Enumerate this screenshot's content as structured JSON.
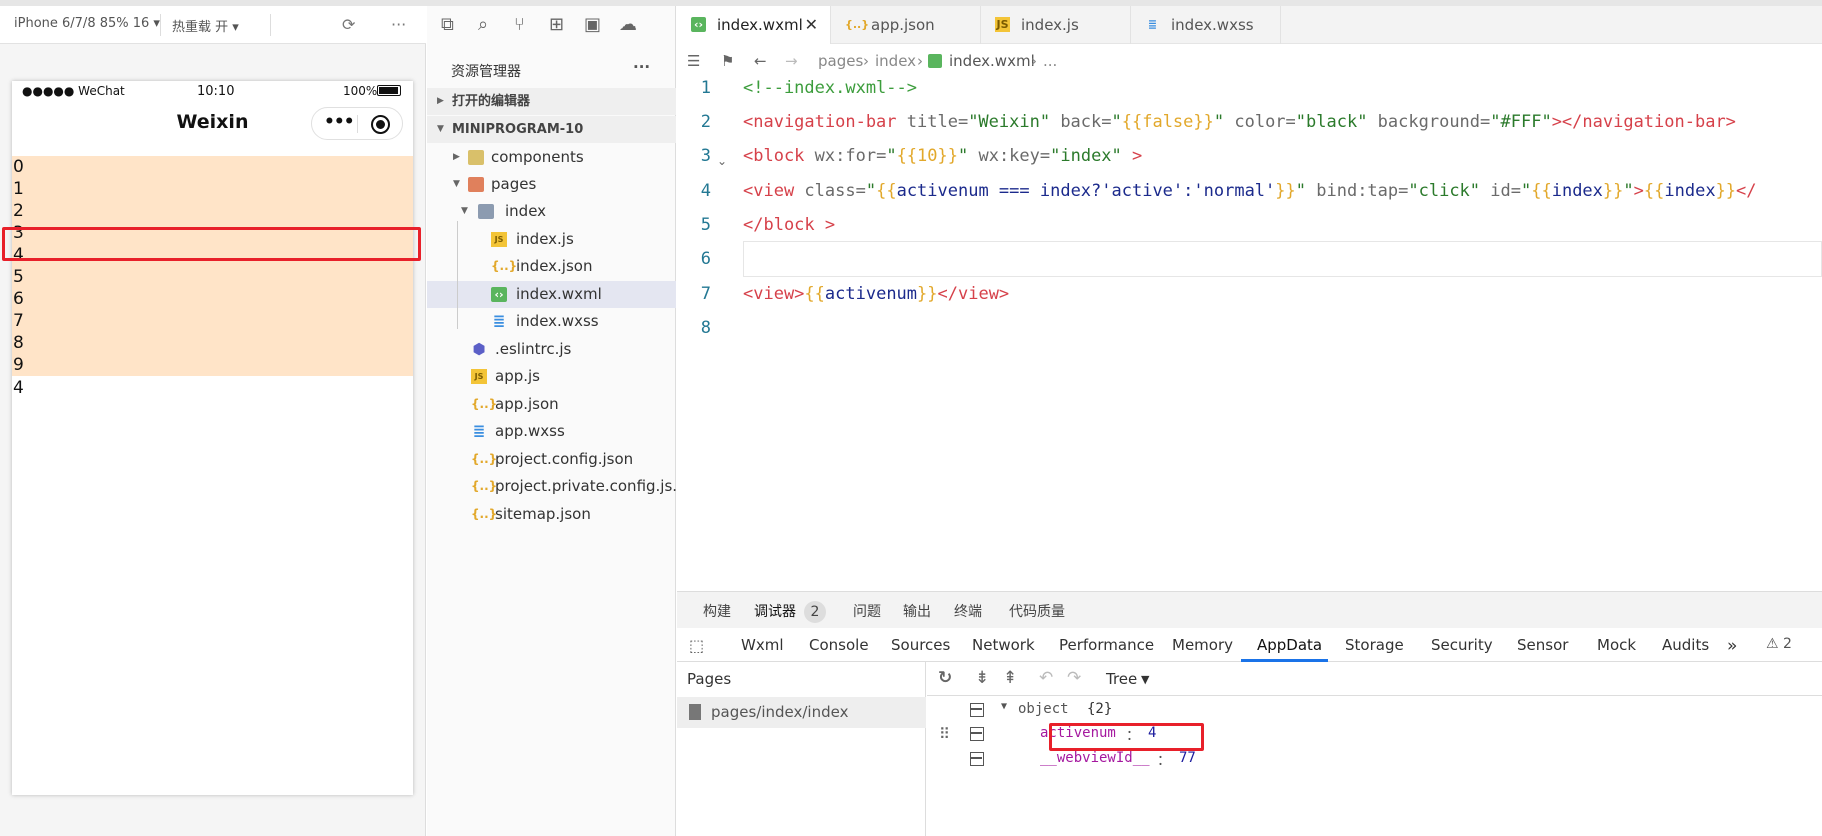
{
  "simulator": {
    "device_label": "iPhone 6/7/8 85% 16 ▾",
    "hot_reload_label": "热重载 开 ▾",
    "refresh_icon": "refresh-icon",
    "more_icon": "more-icon",
    "status_signal": "●●●●● WeChat",
    "status_time": "10:10",
    "status_battery": "100%",
    "nav_title": "Weixin",
    "list_items": [
      "0",
      "1",
      "2",
      "3",
      "4",
      "5",
      "6",
      "7",
      "8",
      "9"
    ],
    "active_index": 4,
    "result_value": "4"
  },
  "explorer": {
    "title": "资源管理器",
    "more": "···",
    "open_editors_label": "打开的编辑器",
    "project_label": "MINIPROGRAM-10",
    "tree": [
      {
        "label": "components",
        "icon": "folder-icon"
      },
      {
        "label": "pages",
        "icon": "folder-icon"
      },
      {
        "label": "index",
        "icon": "folder-icon"
      },
      {
        "label": "index.js",
        "icon": "js-file-icon"
      },
      {
        "label": "index.json",
        "icon": "json-file-icon"
      },
      {
        "label": "index.wxml",
        "icon": "wxml-file-icon"
      },
      {
        "label": "index.wxss",
        "icon": "wxss-file-icon"
      },
      {
        "label": ".eslintrc.js",
        "icon": "eslint-file-icon"
      },
      {
        "label": "app.js",
        "icon": "js-file-icon"
      },
      {
        "label": "app.json",
        "icon": "json-file-icon"
      },
      {
        "label": "app.wxss",
        "icon": "wxss-file-icon"
      },
      {
        "label": "project.config.json",
        "icon": "json-file-icon"
      },
      {
        "label": "project.private.config.js...",
        "icon": "json-file-icon"
      },
      {
        "label": "sitemap.json",
        "icon": "json-file-icon"
      }
    ]
  },
  "editor": {
    "tabs": [
      "index.wxml",
      "app.json",
      "index.js",
      "index.wxss"
    ],
    "close": "✕",
    "breadcrumb": [
      "pages",
      "index",
      "index.wxml",
      "..."
    ],
    "line_numbers": [
      "1",
      "2",
      "3",
      "4",
      "5",
      "6",
      "7",
      "8"
    ],
    "code": {
      "l1": "<!--index.wxml-->",
      "l2_open": "<navigation-bar ",
      "l2_a1": "title=",
      "l2_v1": "\"Weixin\"",
      "l2_a2": " back=",
      "l2_v2q1": "\"",
      "l2_v2": "{{false}}",
      "l2_v2q2": "\"",
      "l2_a3": " color=",
      "l2_v3": "\"black\"",
      "l2_a4": " background=",
      "l2_v4": "\"#FFF\"",
      "l2_close": "></navigation-bar>",
      "l3_open": "<block ",
      "l3_a1": "wx:for=",
      "l3_q1": "\"",
      "l3_v1": "{{10}}",
      "l3_q2": "\"",
      "l3_a2": " wx:key=",
      "l3_v2": "\"index\"",
      "l3_close": " >",
      "l4_open": "<view ",
      "l4_a1": "class=",
      "l4_q1": "\"",
      "l4_b1": "{{",
      "l4_v1": "activenum === index?'active':'normal'",
      "l4_b2": "}}",
      "l4_q2": "\"",
      "l4_a2": " bind:tap=",
      "l4_v2": "\"click\"",
      "l4_a3": " id=",
      "l4_q3": "\"",
      "l4_b3": "{{",
      "l4_v3": "index",
      "l4_b4": "}}",
      "l4_q4": "\"",
      "l4_gt": ">",
      "l4_b5": "{{",
      "l4_v5": "index",
      "l4_b6": "}}",
      "l4_tail": "</",
      "l5": "</block >",
      "l7_open": "<view>",
      "l7_b1": "{{",
      "l7_v": "activenum",
      "l7_b2": "}}",
      "l7_close": "</view>"
    }
  },
  "debugger": {
    "top_tabs": [
      "构建",
      "调试器",
      "问题",
      "输出",
      "终端",
      "代码质量"
    ],
    "badge": "2",
    "panel_tabs": [
      "Wxml",
      "Console",
      "Sources",
      "Network",
      "Performance",
      "Memory",
      "AppData",
      "Storage",
      "Security",
      "Sensor",
      "Mock",
      "Audits"
    ],
    "more_tabs": "»",
    "warning_count": "⚠ 2",
    "pages_header": "Pages",
    "page_item": "pages/index/index",
    "tree_mode": "Tree",
    "tree_caret": "▼",
    "obj_label": "object",
    "obj_count": "{2}",
    "rows": [
      {
        "key": "activenum",
        "value": "4"
      },
      {
        "key": "__webviewId__",
        "value": "77"
      }
    ],
    "colon": "："
  }
}
